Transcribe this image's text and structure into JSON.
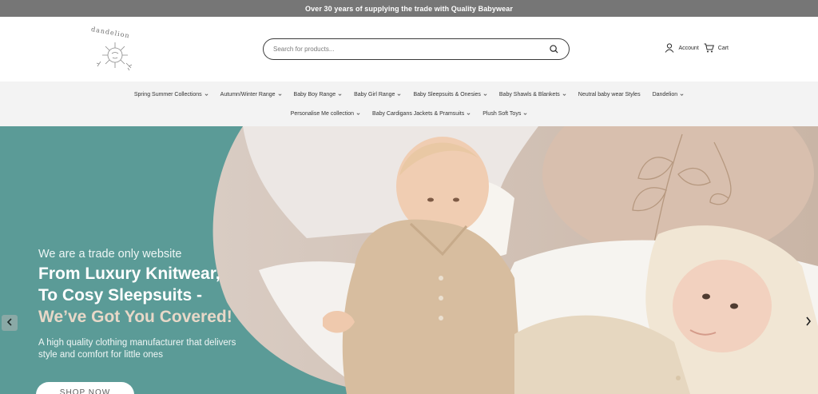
{
  "announcement": {
    "text": "Over 30 years of supplying the trade with Quality Babywear"
  },
  "header": {
    "logo_text": "dandelion",
    "search": {
      "placeholder": "Search for products..."
    },
    "account_label": "Account",
    "cart_label": "Cart"
  },
  "nav": {
    "row1": [
      {
        "label": "Spring Summer Collections",
        "has_dropdown": true
      },
      {
        "label": "Autumn/Winter Range",
        "has_dropdown": true
      },
      {
        "label": "Baby Boy Range",
        "has_dropdown": true
      },
      {
        "label": "Baby Girl Range",
        "has_dropdown": true
      },
      {
        "label": "Baby Sleepsuits & Onesies",
        "has_dropdown": true
      },
      {
        "label": "Baby Shawls & Blankets",
        "has_dropdown": true
      },
      {
        "label": "Neutral baby wear Styles",
        "has_dropdown": false
      },
      {
        "label": "Dandelion",
        "has_dropdown": true
      }
    ],
    "row2": [
      {
        "label": "Personalise Me collection",
        "has_dropdown": true
      },
      {
        "label": "Baby Cardigans Jackets & Pramsuits",
        "has_dropdown": true
      },
      {
        "label": "Plush Soft Toys",
        "has_dropdown": true
      }
    ]
  },
  "hero": {
    "eyebrow": "We are a trade only website",
    "title_line1": "From Luxury Knitwear,",
    "title_line2": "To Cosy Sleepsuits -",
    "accent": "We’ve Got You Covered!",
    "sub_line1": "A high quality clothing manufacturer that delivers",
    "sub_line2": "style and comfort for little ones",
    "cta": "SHOP NOW"
  },
  "colors": {
    "announcement_bg": "#767676",
    "hero_bg": "#5b9b97",
    "hero_accent": "#e8d8c8",
    "nav_bg": "#f3f3f3"
  },
  "icons": [
    "search-icon",
    "account-icon",
    "cart-icon",
    "chevron-down-icon",
    "slider-prev-icon",
    "slider-next-icon"
  ]
}
